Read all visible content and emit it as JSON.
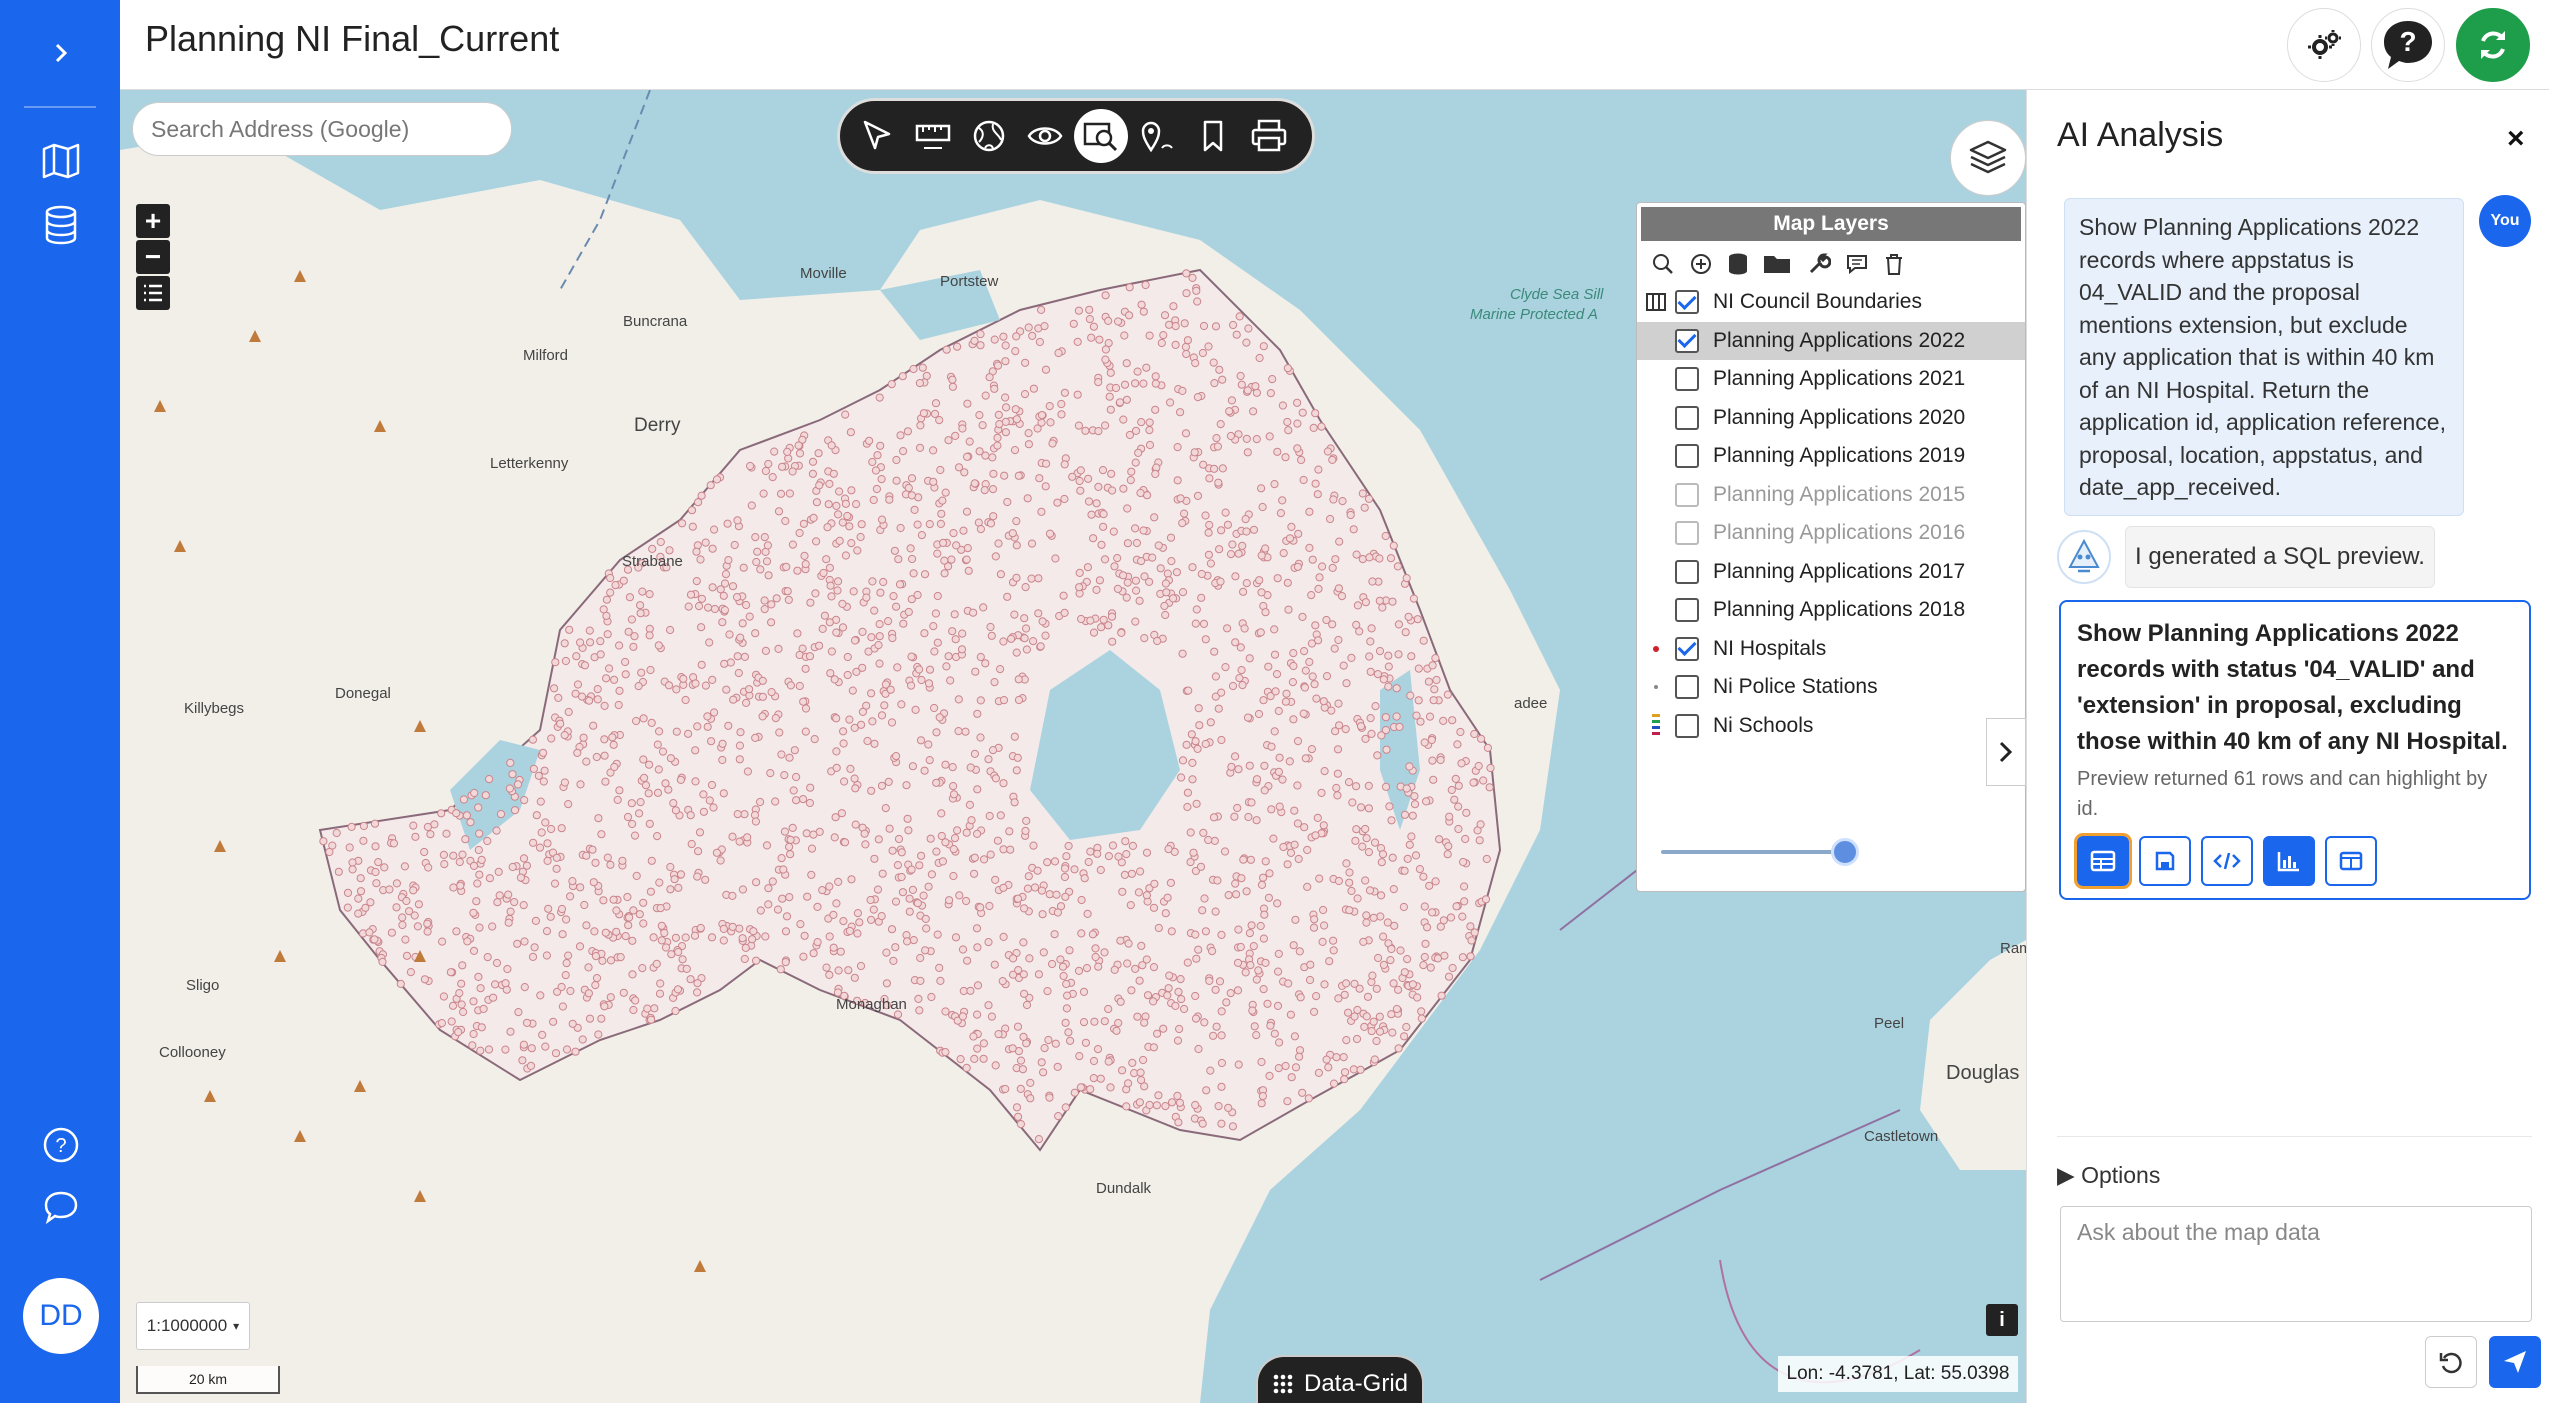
{
  "header": {
    "title": "Planning NI Final_Current"
  },
  "sidebar": {
    "items": [
      {
        "icon": "chevron-right-icon"
      },
      {
        "icon": "map-icon"
      },
      {
        "icon": "database-icon"
      },
      {
        "icon": "help-circle-icon"
      },
      {
        "icon": "chat-icon"
      }
    ],
    "avatar": "DD"
  },
  "header_buttons": [
    {
      "icon": "settings-icon"
    },
    {
      "icon": "help-icon"
    },
    {
      "icon": "refresh-icon",
      "color": "#1e9e4a"
    }
  ],
  "map": {
    "search_placeholder": "Search Address (Google)",
    "toolbar": [
      {
        "icon": "select-pointer-icon"
      },
      {
        "icon": "measure-icon"
      },
      {
        "icon": "globe-icon"
      },
      {
        "icon": "eye-icon"
      },
      {
        "icon": "search-area-icon",
        "active": true
      },
      {
        "icon": "location-pin-icon"
      },
      {
        "icon": "bookmark-icon"
      },
      {
        "icon": "print-icon"
      }
    ],
    "zoom_in": "+",
    "zoom_out": "−",
    "scale_select": "1:1000000",
    "scalebar": "20 km",
    "data_grid": "Data-Grid",
    "coords": "Lon: -4.3781, Lat: 55.0398",
    "info": "i",
    "places": [
      "Moville",
      "Portstew",
      "Buncrana",
      "Milford",
      "Letterkenny",
      "Derry",
      "Strabane",
      "Killybegs",
      "Donegal",
      "Sligo",
      "Collooney",
      "Monaghan",
      "Dundalk",
      "Peel",
      "Douglas",
      "Castletown",
      "Rams",
      "adee",
      "Clyde Sea Sill",
      "Marine Protected A"
    ],
    "colors": {
      "sea": "#aad3df",
      "land": "#f2efe9",
      "ni_land": "#f5ecec",
      "points": "#c9858c"
    }
  },
  "layers": {
    "title": "Map Layers",
    "items": [
      {
        "label": "NI Council Boundaries",
        "checked": true,
        "legend": "boundary"
      },
      {
        "label": "Planning Applications 2022",
        "checked": true,
        "selected": true
      },
      {
        "label": "Planning Applications 2021",
        "checked": false
      },
      {
        "label": "Planning Applications 2020",
        "checked": false
      },
      {
        "label": "Planning Applications 2019",
        "checked": false
      },
      {
        "label": "Planning Applications 2015",
        "checked": false,
        "dim": true
      },
      {
        "label": "Planning Applications 2016",
        "checked": false,
        "dim": true
      },
      {
        "label": "Planning Applications 2017",
        "checked": false
      },
      {
        "label": "Planning Applications 2018",
        "checked": false
      },
      {
        "label": "NI Hospitals",
        "checked": true,
        "legend": "red-dot"
      },
      {
        "label": "Ni Police Stations",
        "checked": false,
        "legend": "small-dot"
      },
      {
        "label": "Ni Schools",
        "checked": false,
        "legend": "multi"
      }
    ],
    "opacity": 0.95
  },
  "panel": {
    "title": "AI Analysis",
    "close": "×",
    "user_badge": "You",
    "user_message": "Show Planning Applications 2022 records where appstatus is 04_VALID and the proposal mentions extension, but exclude any application that is within 40 km of an NI Hospital. Return the application id, application reference, proposal, location, appstatus, and date_app_received.",
    "bot_message": "I generated a SQL preview.",
    "card_title": "Show Planning Applications 2022 records with status '04_VALID' and 'extension' in proposal, excluding those within 40 km of any NI Hospital.",
    "card_subtitle": "Preview returned 61 rows and can highlight by id.",
    "card_actions": [
      {
        "icon": "table-icon"
      },
      {
        "icon": "save-icon"
      },
      {
        "icon": "code-icon"
      },
      {
        "icon": "chart-icon"
      },
      {
        "icon": "columns-icon"
      }
    ],
    "options": "▶ Options",
    "ask_placeholder": "Ask about the map data"
  }
}
